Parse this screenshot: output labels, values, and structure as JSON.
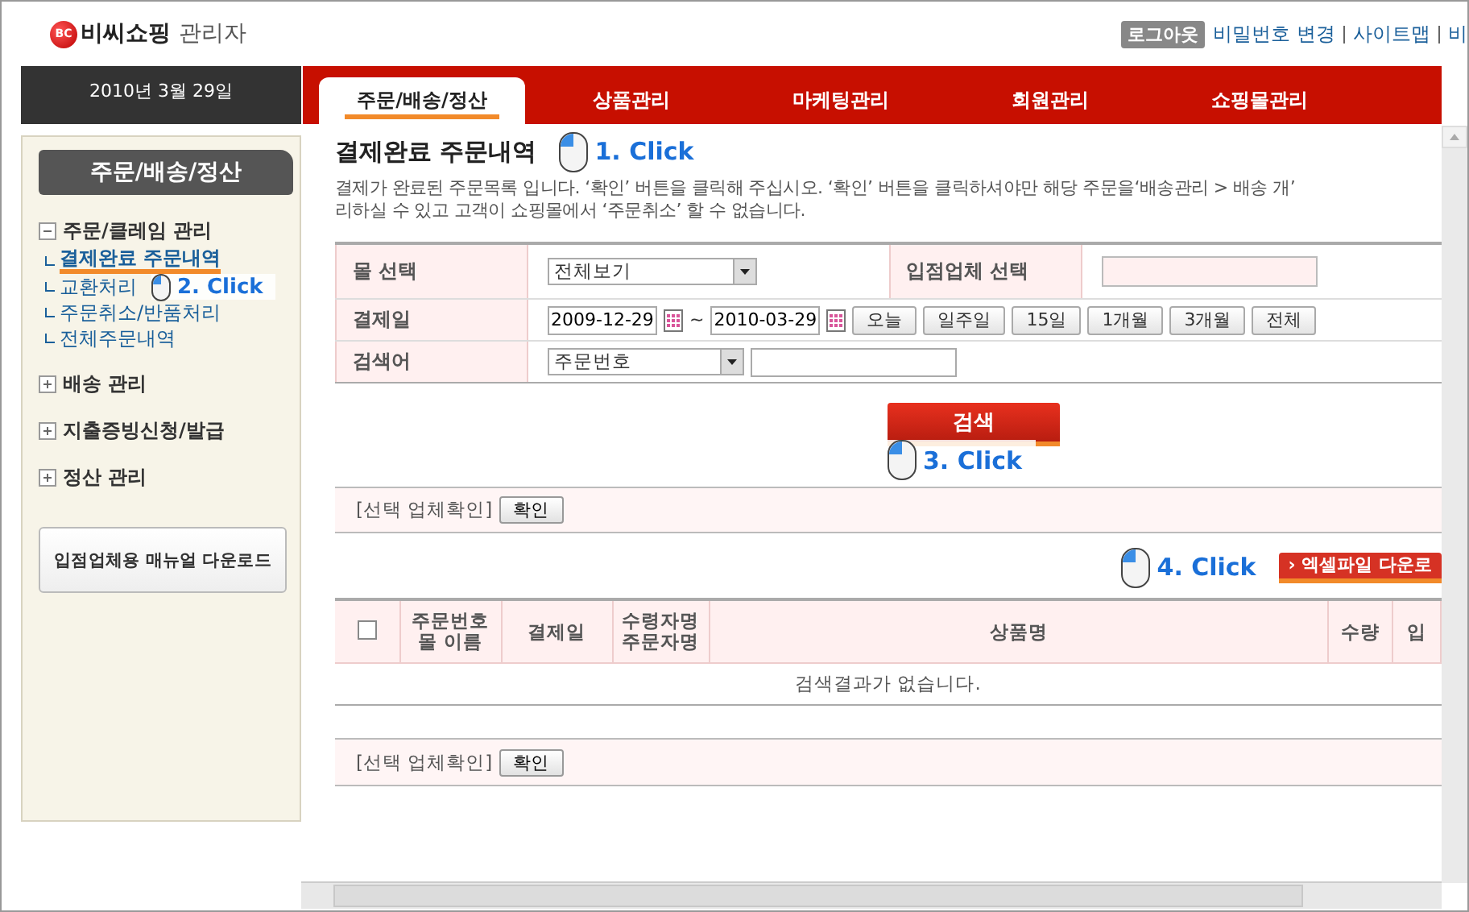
{
  "header": {
    "logo_mark": "BC",
    "logo": "비씨쇼핑",
    "logo_suffix": "관리자",
    "logout": "로그아웃",
    "links": [
      "비밀번호 변경",
      "사이트맵",
      "비"
    ]
  },
  "date": "2010년 3월 29일",
  "tabs": [
    {
      "label": "주문/배송/정산",
      "selected": true
    },
    {
      "label": "상품관리",
      "selected": false
    },
    {
      "label": "마케팅관리",
      "selected": false
    },
    {
      "label": "회원관리",
      "selected": false
    },
    {
      "label": "쇼핑몰관리",
      "selected": false
    }
  ],
  "sidebar": {
    "title": "주문/배송/정산",
    "groups": [
      {
        "label": "주문/클레임 관리",
        "expanded": true,
        "children": [
          {
            "label": "결제완료 주문내역",
            "selected": true
          },
          {
            "label": "교환처리",
            "selected": false
          },
          {
            "label": "주문취소/반품처리",
            "selected": false
          },
          {
            "label": "전체주문내역",
            "selected": false
          }
        ]
      },
      {
        "label": "배송 관리",
        "expanded": false
      },
      {
        "label": "지출증빙신청/발급",
        "expanded": false
      },
      {
        "label": "정산 관리",
        "expanded": false
      }
    ],
    "manual_button": "**입점업체용** 매뉴얼 다운로드"
  },
  "page": {
    "title": "결제완료 주문내역",
    "description": [
      "결제가 완료된 주문목록 입니다. ‘확인’ 버튼을 클릭해 주십시오. ‘확인’ 버튼을 클릭하셔야만 해당 주문을‘배송관리 > 배송 개’",
      "리하실 수 있고 고객이 쇼핑몰에서 ‘주문취소’ 할 수 없습니다."
    ]
  },
  "search_form": {
    "mall_label": "몰 선택",
    "mall_value": "전체보기",
    "vendor_label": "입점업체 선택",
    "date_label": "결제일",
    "date_from": "2009-12-29",
    "date_sep": "~",
    "date_to": "2010-03-29",
    "period_buttons": [
      "오늘",
      "일주일",
      "15일",
      "1개월",
      "3개월",
      "전체"
    ],
    "keyword_label": "검색어",
    "keyword_type": "주문번호",
    "search_button": "검색"
  },
  "confirm_bars": [
    {
      "label": "[선택 업체확인]",
      "button": "확인"
    },
    {
      "label": "[선택 업체확인]",
      "button": "확인"
    }
  ],
  "excel_button": {
    "icon": "›",
    "label": "엑셀파일 다운로"
  },
  "table": {
    "columns": [
      {
        "kind": "checkbox",
        "checked": false
      },
      {
        "kind": "text",
        "lines": [
          "주문번호",
          "몰 이름"
        ]
      },
      {
        "kind": "text",
        "lines": [
          "결제일"
        ]
      },
      {
        "kind": "text",
        "lines": [
          "수령자명",
          "주문자명"
        ]
      },
      {
        "kind": "text",
        "lines": [
          "상품명"
        ]
      },
      {
        "kind": "text",
        "lines": [
          "수량"
        ]
      },
      {
        "kind": "text",
        "lines": [
          "입"
        ]
      }
    ],
    "empty_message": "검색결과가 없습니다."
  },
  "callouts": [
    {
      "kind": "tab",
      "label": "1. Click"
    },
    {
      "kind": "menu",
      "label": "2. Click"
    },
    {
      "kind": "search",
      "label": "3. Click"
    },
    {
      "kind": "excel",
      "label": "4. Click"
    }
  ]
}
